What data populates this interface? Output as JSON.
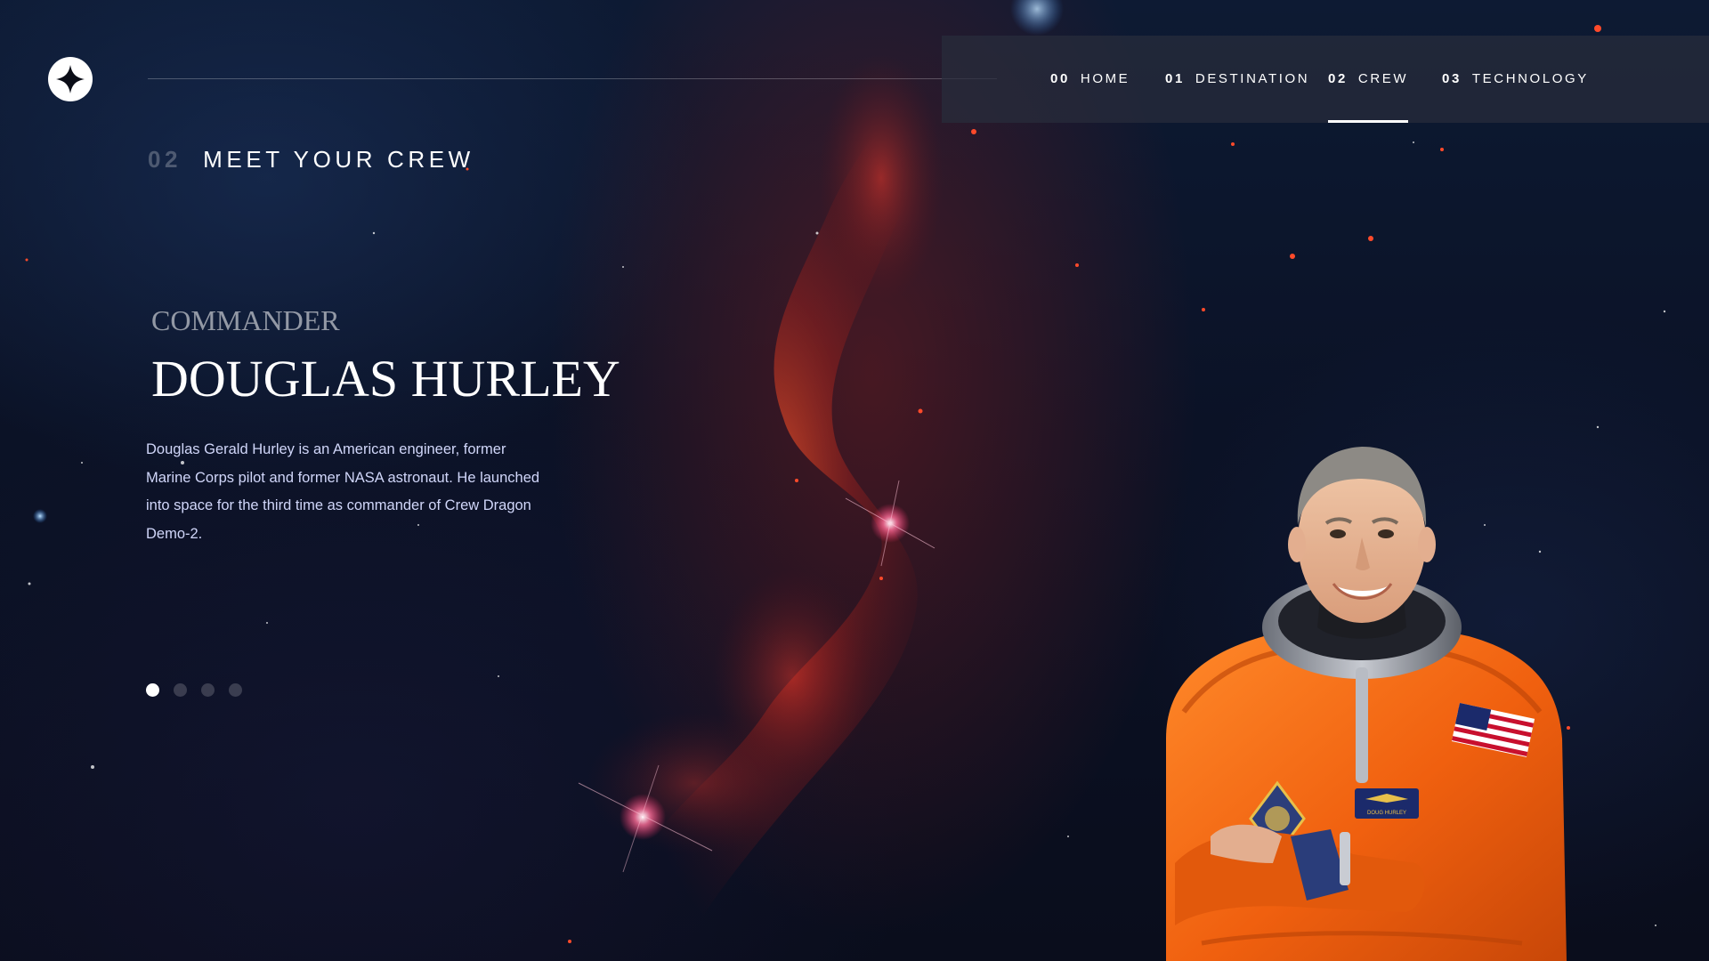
{
  "nav": {
    "items": [
      {
        "num": "00",
        "label": "HOME"
      },
      {
        "num": "01",
        "label": "DESTINATION"
      },
      {
        "num": "02",
        "label": "CREW"
      },
      {
        "num": "03",
        "label": "TECHNOLOGY"
      }
    ],
    "active_index": 2
  },
  "page": {
    "heading_num": "02",
    "heading": "MEET YOUR CREW"
  },
  "crew": {
    "role": "COMMANDER",
    "name": "DOUGLAS HURLEY",
    "bio": "Douglas Gerald Hurley is an American engineer, former Marine Corps pilot and former NASA astronaut. He launched into space for the third time as commander of Crew Dragon Demo-2.",
    "badge_text": "DOUG HURLEY",
    "slide_count": 4,
    "active_slide": 0
  },
  "icons": {
    "logo": "four-point-star-logo-icon"
  },
  "colors": {
    "background": "#0b0d17",
    "text_primary": "#ffffff",
    "text_secondary": "#d0d6f9",
    "nebula": "#c0301f",
    "suit": "#f26a12"
  }
}
